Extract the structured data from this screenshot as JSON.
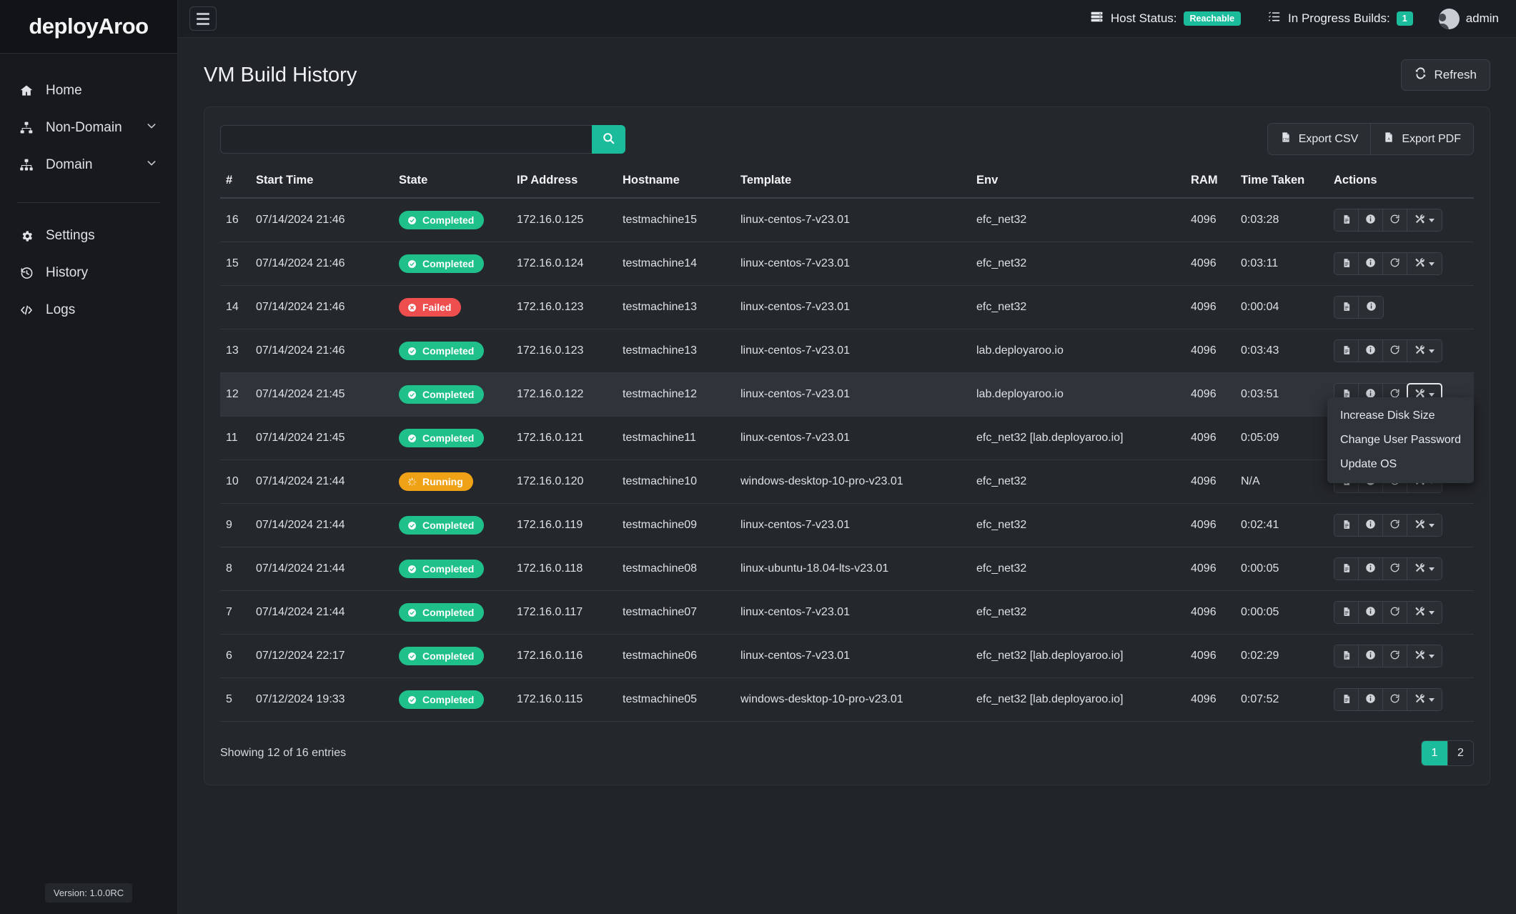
{
  "brand": {
    "name": "deployAroo"
  },
  "sidebar": {
    "items": [
      {
        "label": "Home",
        "icon": "home-icon",
        "caret": false
      },
      {
        "label": "Non-Domain",
        "icon": "sitemap-icon",
        "caret": true
      },
      {
        "label": "Domain",
        "icon": "network-icon",
        "caret": true
      }
    ],
    "secondary_items": [
      {
        "label": "Settings",
        "icon": "gear-icon"
      },
      {
        "label": "History",
        "icon": "history-icon"
      },
      {
        "label": "Logs",
        "icon": "code-icon"
      }
    ],
    "version": "Version: 1.0.0RC"
  },
  "topbar": {
    "menu_toggle": "hamburger-icon",
    "host_status_label": "Host Status:",
    "host_status_value": "Reachable",
    "in_progress_label": "In Progress Builds:",
    "in_progress_value": "1",
    "user": "admin"
  },
  "page": {
    "title": "VM Build History",
    "refresh_label": "Refresh"
  },
  "toolbar": {
    "search_value": "",
    "search_placeholder": "",
    "export_csv_label": "Export CSV",
    "export_pdf_label": "Export PDF"
  },
  "table": {
    "columns": [
      "#",
      "Start Time",
      "State",
      "IP Address",
      "Hostname",
      "Template",
      "Env",
      "RAM",
      "Time Taken",
      "Actions"
    ],
    "rows": [
      {
        "num": "16",
        "start": "07/14/2024 21:46",
        "state": "Completed",
        "ip": "172.16.0.125",
        "host": "testmachine15",
        "template": "linux-centos-7-v23.01",
        "env": "efc_net32",
        "ram": "4096",
        "time": "0:03:28",
        "actions": [
          "log",
          "info",
          "rebuild",
          "tools"
        ]
      },
      {
        "num": "15",
        "start": "07/14/2024 21:46",
        "state": "Completed",
        "ip": "172.16.0.124",
        "host": "testmachine14",
        "template": "linux-centos-7-v23.01",
        "env": "efc_net32",
        "ram": "4096",
        "time": "0:03:11",
        "actions": [
          "log",
          "info",
          "rebuild",
          "tools"
        ]
      },
      {
        "num": "14",
        "start": "07/14/2024 21:46",
        "state": "Failed",
        "ip": "172.16.0.123",
        "host": "testmachine13",
        "template": "linux-centos-7-v23.01",
        "env": "efc_net32",
        "ram": "4096",
        "time": "0:00:04",
        "actions": [
          "log",
          "info"
        ]
      },
      {
        "num": "13",
        "start": "07/14/2024 21:46",
        "state": "Completed",
        "ip": "172.16.0.123",
        "host": "testmachine13",
        "template": "linux-centos-7-v23.01",
        "env": "lab.deployaroo.io",
        "ram": "4096",
        "time": "0:03:43",
        "actions": [
          "log",
          "info",
          "rebuild",
          "tools"
        ]
      },
      {
        "num": "12",
        "start": "07/14/2024 21:45",
        "state": "Completed",
        "ip": "172.16.0.122",
        "host": "testmachine12",
        "template": "linux-centos-7-v23.01",
        "env": "lab.deployaroo.io",
        "ram": "4096",
        "time": "0:03:51",
        "actions": [
          "log",
          "info",
          "rebuild",
          "tools"
        ],
        "active": true,
        "menu_open": true
      },
      {
        "num": "11",
        "start": "07/14/2024 21:45",
        "state": "Completed",
        "ip": "172.16.0.121",
        "host": "testmachine11",
        "template": "linux-centos-7-v23.01",
        "env": "efc_net32 [lab.deployaroo.io]",
        "ram": "4096",
        "time": "0:05:09",
        "actions": [
          "log",
          "info",
          "rebuild",
          "tools"
        ]
      },
      {
        "num": "10",
        "start": "07/14/2024 21:44",
        "state": "Running",
        "ip": "172.16.0.120",
        "host": "testmachine10",
        "template": "windows-desktop-10-pro-v23.01",
        "env": "efc_net32",
        "ram": "4096",
        "time": "N/A",
        "actions": [
          "log",
          "info",
          "rebuild",
          "tools"
        ]
      },
      {
        "num": "9",
        "start": "07/14/2024 21:44",
        "state": "Completed",
        "ip": "172.16.0.119",
        "host": "testmachine09",
        "template": "linux-centos-7-v23.01",
        "env": "efc_net32",
        "ram": "4096",
        "time": "0:02:41",
        "actions": [
          "log",
          "info",
          "rebuild",
          "tools"
        ]
      },
      {
        "num": "8",
        "start": "07/14/2024 21:44",
        "state": "Completed",
        "ip": "172.16.0.118",
        "host": "testmachine08",
        "template": "linux-ubuntu-18.04-lts-v23.01",
        "env": "efc_net32",
        "ram": "4096",
        "time": "0:00:05",
        "actions": [
          "log",
          "info",
          "rebuild",
          "tools"
        ]
      },
      {
        "num": "7",
        "start": "07/14/2024 21:44",
        "state": "Completed",
        "ip": "172.16.0.117",
        "host": "testmachine07",
        "template": "linux-centos-7-v23.01",
        "env": "efc_net32",
        "ram": "4096",
        "time": "0:00:05",
        "actions": [
          "log",
          "info",
          "rebuild",
          "tools"
        ]
      },
      {
        "num": "6",
        "start": "07/12/2024 22:17",
        "state": "Completed",
        "ip": "172.16.0.116",
        "host": "testmachine06",
        "template": "linux-centos-7-v23.01",
        "env": "efc_net32 [lab.deployaroo.io]",
        "ram": "4096",
        "time": "0:02:29",
        "actions": [
          "log",
          "info",
          "rebuild",
          "tools"
        ]
      },
      {
        "num": "5",
        "start": "07/12/2024 19:33",
        "state": "Completed",
        "ip": "172.16.0.115",
        "host": "testmachine05",
        "template": "windows-desktop-10-pro-v23.01",
        "env": "efc_net32 [lab.deployaroo.io]",
        "ram": "4096",
        "time": "0:07:52",
        "actions": [
          "log",
          "info",
          "rebuild",
          "tools"
        ]
      }
    ]
  },
  "actions_menu": {
    "items": [
      "Increase Disk Size",
      "Change User Password",
      "Update OS"
    ]
  },
  "footer": {
    "entries_text": "Showing 12 of 16 entries",
    "pages": [
      "1",
      "2"
    ],
    "active_page": "1"
  },
  "colors": {
    "accent": "#1abc9c",
    "completed": "#1fc08a",
    "failed": "#ef4e4e",
    "running": "#f0a217"
  }
}
